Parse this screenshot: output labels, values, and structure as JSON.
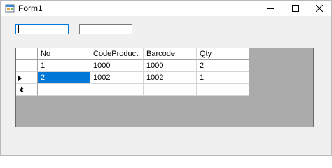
{
  "window": {
    "title": "Form1",
    "app_icon": "winforms-form-icon"
  },
  "titlebar_buttons": {
    "minimize_icon": "minimize-icon",
    "maximize_icon": "maximize-icon",
    "close_icon": "close-icon"
  },
  "inputs": {
    "textbox1_value": "",
    "textbox2_value": ""
  },
  "grid": {
    "columns": [
      "No",
      "CodeProduct",
      "Barcode",
      "Qty"
    ],
    "rows": [
      [
        "1",
        "1000",
        "1000",
        "2"
      ],
      [
        "2",
        "1002",
        "1002",
        "1"
      ]
    ],
    "current_row_indicator": "current-row-arrow-icon",
    "new_row_indicator": "new-row-asterisk-icon",
    "selection_color": "#0078d7",
    "background_color": "#ababab"
  }
}
